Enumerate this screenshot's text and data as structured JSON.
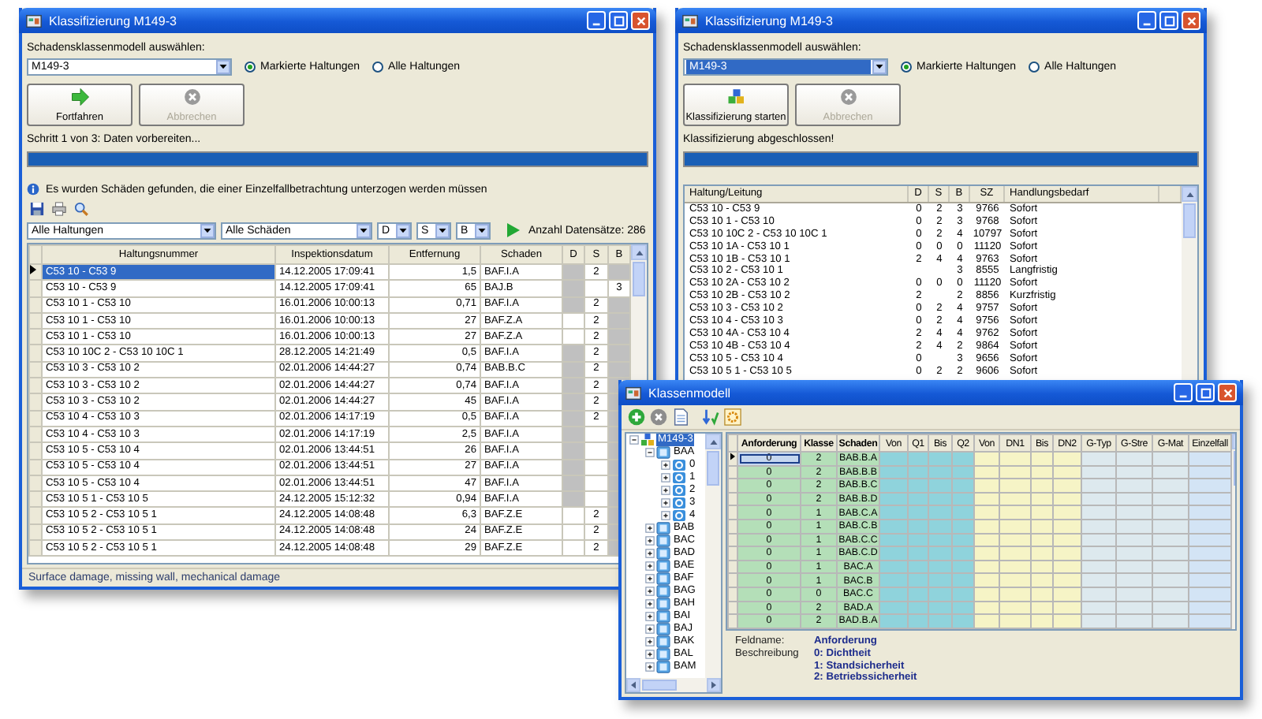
{
  "classification_window": {
    "title": "Klassifizierung M149-3",
    "model_label": "Schadensklassenmodell auswählen:",
    "model": {
      "value": "M149-3",
      "highlighted": false
    },
    "radios": [
      {
        "label": "Markierte Haltungen",
        "selected": true
      },
      {
        "label": "Alle Haltungen",
        "selected": false
      }
    ],
    "buttons": [
      {
        "kind": "continue",
        "label": "Fortfahren",
        "disabled": false
      },
      {
        "kind": "cancel",
        "label": "Abbrechen",
        "disabled": true
      }
    ],
    "step_text": "Schritt 1 von 3: Daten vorbereiten...",
    "progress": {
      "level": 1
    },
    "info_text": "Es wurden Schäden gefunden, die einer Einzelfallbetrachtung unterzogen werden müssen",
    "filters": [
      {
        "kind": "wide",
        "value": "Alle Haltungen"
      },
      {
        "kind": "medium",
        "value": "Alle Schäden"
      },
      {
        "kind": "narrow",
        "value": "D"
      },
      {
        "kind": "narrow",
        "value": "S"
      },
      {
        "kind": "narrow",
        "value": "B"
      }
    ],
    "count_text": "Anzahl Datensätze: 286",
    "table": {
      "columns": [
        "Haltungsnummer",
        "Inspektionsdatum",
        "Entfernung",
        "Schaden",
        "D",
        "S",
        "B"
      ],
      "rows": [
        {
          "cells": [
            "C53 10 - C53 9",
            "14.12.2005 17:09:41",
            "1,5",
            "BAF.I.A"
          ],
          "s": "2",
          "shaded": true,
          "selected": true
        },
        {
          "cells": [
            "C53 10 - C53 9",
            "14.12.2005 17:09:41",
            "65",
            "BAJ.B"
          ],
          "b": "3",
          "shaded": true,
          "selected": false
        },
        {
          "cells": [
            "C53 10 1 - C53 10",
            "16.01.2006 10:00:13",
            "0,71",
            "BAF.I.A"
          ],
          "s": "2",
          "shaded": true,
          "selected": false
        },
        {
          "cells": [
            "C53 10 1 - C53 10",
            "16.01.2006 10:00:13",
            "27",
            "BAF.Z.A"
          ],
          "s": "2",
          "shaded": false,
          "selected": false
        },
        {
          "cells": [
            "C53 10 1 - C53 10",
            "16.01.2006 10:00:13",
            "27",
            "BAF.Z.A"
          ],
          "s": "2",
          "shaded": false,
          "selected": false
        },
        {
          "cells": [
            "C53 10 10C 2 - C53 10 10C 1",
            "28.12.2005 14:21:49",
            "0,5",
            "BAF.I.A"
          ],
          "s": "2",
          "shaded": true,
          "selected": false
        },
        {
          "cells": [
            "C53 10 3 - C53 10 2",
            "02.01.2006 14:44:27",
            "0,74",
            "BAB.B.C"
          ],
          "s": "2",
          "shaded": true,
          "selected": false
        },
        {
          "cells": [
            "C53 10 3 - C53 10 2",
            "02.01.2006 14:44:27",
            "0,74",
            "BAF.I.A"
          ],
          "s": "2",
          "shaded": true,
          "selected": false
        },
        {
          "cells": [
            "C53 10 3 - C53 10 2",
            "02.01.2006 14:44:27",
            "45",
            "BAF.I.A"
          ],
          "s": "2",
          "shaded": true,
          "selected": false
        },
        {
          "cells": [
            "C53 10 4 - C53 10 3",
            "02.01.2006 14:17:19",
            "0,5",
            "BAF.I.A"
          ],
          "s": "2",
          "shaded": true,
          "selected": false
        },
        {
          "cells": [
            "C53 10 4 - C53 10 3",
            "02.01.2006 14:17:19",
            "2,5",
            "BAF.I.A"
          ],
          "shaded": true,
          "selected": false
        },
        {
          "cells": [
            "C53 10 5 - C53 10 4",
            "02.01.2006 13:44:51",
            "26",
            "BAF.I.A"
          ],
          "shaded": true,
          "selected": false
        },
        {
          "cells": [
            "C53 10 5 - C53 10 4",
            "02.01.2006 13:44:51",
            "27",
            "BAF.I.A"
          ],
          "shaded": true,
          "selected": false
        },
        {
          "cells": [
            "C53 10 5 - C53 10 4",
            "02.01.2006 13:44:51",
            "47",
            "BAF.I.A"
          ],
          "shaded": true,
          "selected": false
        },
        {
          "cells": [
            "C53 10 5 1 - C53 10 5",
            "24.12.2005 15:12:32",
            "0,94",
            "BAF.I.A"
          ],
          "shaded": true,
          "selected": false
        },
        {
          "cells": [
            "C53 10 5 2 - C53 10 5 1",
            "24.12.2005 14:08:48",
            "6,3",
            "BAF.Z.E"
          ],
          "s": "2",
          "shaded": false,
          "selected": false
        },
        {
          "cells": [
            "C53 10 5 2 - C53 10 5 1",
            "24.12.2005 14:08:48",
            "24",
            "BAF.Z.E"
          ],
          "s": "2",
          "shaded": false,
          "selected": false
        },
        {
          "cells": [
            "C53 10 5 2 - C53 10 5 1",
            "24.12.2005 14:08:48",
            "29",
            "BAF.Z.E"
          ],
          "s": "2",
          "shaded": false,
          "selected": false
        }
      ]
    },
    "status_bar": "Surface damage, missing wall, mechanical damage"
  },
  "result_window": {
    "title": "Klassifizierung M149-3",
    "model_label": "Schadensklassenmodell auswählen:",
    "model": {
      "value": "M149-3",
      "highlighted": true
    },
    "radios": [
      {
        "label": "Markierte Haltungen",
        "selected": true
      },
      {
        "label": "Alle Haltungen",
        "selected": false
      }
    ],
    "buttons": [
      {
        "kind": "classify",
        "label": "Klassifizierung starten",
        "disabled": false
      },
      {
        "kind": "cancel",
        "label": "Abbrechen",
        "disabled": true
      }
    ],
    "step_text": "Klassifizierung abgeschlossen!",
    "progress": {
      "level": 1
    },
    "list": {
      "columns": [
        "Haltung/Leitung",
        "D",
        "S",
        "B",
        "SZ",
        "Handlungsbedarf"
      ],
      "rows": [
        {
          "name": "C53 10 - C53 9",
          "d": "0",
          "s": "2",
          "b": "3",
          "sz": "9766",
          "action": "Sofort"
        },
        {
          "name": "C53 10 1 - C53 10",
          "d": "0",
          "s": "2",
          "b": "3",
          "sz": "9768",
          "action": "Sofort"
        },
        {
          "name": "C53 10 10C 2 - C53 10 10C 1",
          "d": "0",
          "s": "2",
          "b": "4",
          "sz": "10797",
          "action": "Sofort"
        },
        {
          "name": "C53 10 1A - C53 10 1",
          "d": "0",
          "s": "0",
          "b": "0",
          "sz": "11120",
          "action": "Sofort"
        },
        {
          "name": "C53 10 1B - C53 10 1",
          "d": "2",
          "s": "4",
          "b": "4",
          "sz": "9763",
          "action": "Sofort"
        },
        {
          "name": "C53 10 2 - C53 10 1",
          "b": "3",
          "sz": "8555",
          "action": "Langfristig"
        },
        {
          "name": "C53 10 2A - C53 10 2",
          "d": "0",
          "s": "0",
          "b": "0",
          "sz": "11120",
          "action": "Sofort"
        },
        {
          "name": "C53 10 2B - C53 10 2",
          "d": "2",
          "b": "2",
          "sz": "8856",
          "action": "Kurzfristig"
        },
        {
          "name": "C53 10 3 - C53 10 2",
          "d": "0",
          "s": "2",
          "b": "4",
          "sz": "9757",
          "action": "Sofort"
        },
        {
          "name": "C53 10 4 - C53 10 3",
          "d": "0",
          "s": "2",
          "b": "4",
          "sz": "9756",
          "action": "Sofort"
        },
        {
          "name": "C53 10 4A - C53 10 4",
          "d": "2",
          "s": "4",
          "b": "4",
          "sz": "9762",
          "action": "Sofort"
        },
        {
          "name": "C53 10 4B - C53 10 4",
          "d": "2",
          "s": "4",
          "b": "2",
          "sz": "9864",
          "action": "Sofort"
        },
        {
          "name": "C53 10 5 - C53 10 4",
          "d": "0",
          "b": "3",
          "sz": "9656",
          "action": "Sofort"
        },
        {
          "name": "C53 10 5 1 - C53 10 5",
          "d": "0",
          "s": "2",
          "b": "2",
          "sz": "9606",
          "action": "Sofort"
        }
      ]
    }
  },
  "class_model_window": {
    "title": "Klassenmodell",
    "tree": [
      {
        "label": "M149-3",
        "selected": true,
        "expanded": true,
        "children": [
          {
            "label": "BAA",
            "selected": false,
            "expanded": true,
            "children": [
              {
                "label": "0",
                "selected": false,
                "expanded": false
              },
              {
                "label": "1",
                "selected": false,
                "expanded": false
              },
              {
                "label": "2",
                "selected": false,
                "expanded": false
              },
              {
                "label": "3",
                "selected": false,
                "expanded": false
              },
              {
                "label": "4",
                "selected": false,
                "expanded": false
              }
            ]
          },
          {
            "label": "BAB",
            "selected": false,
            "expanded": false
          },
          {
            "label": "BAC",
            "selected": false,
            "expanded": false
          },
          {
            "label": "BAD",
            "selected": false,
            "expanded": false
          },
          {
            "label": "BAE",
            "selected": false,
            "expanded": false
          },
          {
            "label": "BAF",
            "selected": false,
            "expanded": false
          },
          {
            "label": "BAG",
            "selected": false,
            "expanded": false
          },
          {
            "label": "BAH",
            "selected": false,
            "expanded": false
          },
          {
            "label": "BAI",
            "selected": false,
            "expanded": false
          },
          {
            "label": "BAJ",
            "selected": false,
            "expanded": false
          },
          {
            "label": "BAK",
            "selected": false,
            "expanded": false
          },
          {
            "label": "BAL",
            "selected": false,
            "expanded": false
          },
          {
            "label": "BAM",
            "selected": false,
            "expanded": false
          }
        ]
      }
    ],
    "grid": {
      "columns": [
        {
          "label": "Anforderung",
          "color": "#b4dfb8"
        },
        {
          "label": "Klasse",
          "color": "#b4dfb8"
        },
        {
          "label": "Schaden",
          "color": "#b4dfb8"
        },
        {
          "label": "Von",
          "color": "#8fd3dc"
        },
        {
          "label": "Q1",
          "color": "#8fd3dc"
        },
        {
          "label": "Bis",
          "color": "#8fd3dc"
        },
        {
          "label": "Q2",
          "color": "#8fd3dc"
        },
        {
          "label": "Von",
          "color": "#f6f4c6"
        },
        {
          "label": "DN1",
          "color": "#f6f4c6"
        },
        {
          "label": "Bis",
          "color": "#f6f4c6"
        },
        {
          "label": "DN2",
          "color": "#f6f4c6"
        },
        {
          "label": "G-Typ",
          "color": "#dde9ee"
        },
        {
          "label": "G-Stre",
          "color": "#dde9ee"
        },
        {
          "label": "G-Mat",
          "color": "#dde9ee"
        },
        {
          "label": "Einzelfall",
          "color": "#d3e4f5"
        }
      ],
      "rows": [
        {
          "cells": [
            "0",
            "2",
            "BAB.B.A"
          ],
          "selected": true
        },
        {
          "cells": [
            "0",
            "2",
            "BAB.B.B"
          ],
          "selected": false
        },
        {
          "cells": [
            "0",
            "2",
            "BAB.B.C"
          ],
          "selected": false
        },
        {
          "cells": [
            "0",
            "2",
            "BAB.B.D"
          ],
          "selected": false
        },
        {
          "cells": [
            "0",
            "1",
            "BAB.C.A"
          ],
          "selected": false
        },
        {
          "cells": [
            "0",
            "1",
            "BAB.C.B"
          ],
          "selected": false
        },
        {
          "cells": [
            "0",
            "1",
            "BAB.C.C"
          ],
          "selected": false
        },
        {
          "cells": [
            "0",
            "1",
            "BAB.C.D"
          ],
          "selected": false
        },
        {
          "cells": [
            "0",
            "1",
            "BAC.A"
          ],
          "selected": false
        },
        {
          "cells": [
            "0",
            "1",
            "BAC.B"
          ],
          "selected": false
        },
        {
          "cells": [
            "0",
            "0",
            "BAC.C"
          ],
          "selected": false
        },
        {
          "cells": [
            "0",
            "2",
            "BAD.A"
          ],
          "selected": false
        },
        {
          "cells": [
            "0",
            "2",
            "BAD.B.A"
          ],
          "selected": false
        }
      ]
    },
    "details": {
      "field_label": "Feldname:",
      "field_value": "Anforderung",
      "description_label": "Beschreibung",
      "description_lines": [
        "0: Dichtheit",
        "1: Standsicherheit",
        "2: Betriebssicherheit"
      ]
    }
  }
}
